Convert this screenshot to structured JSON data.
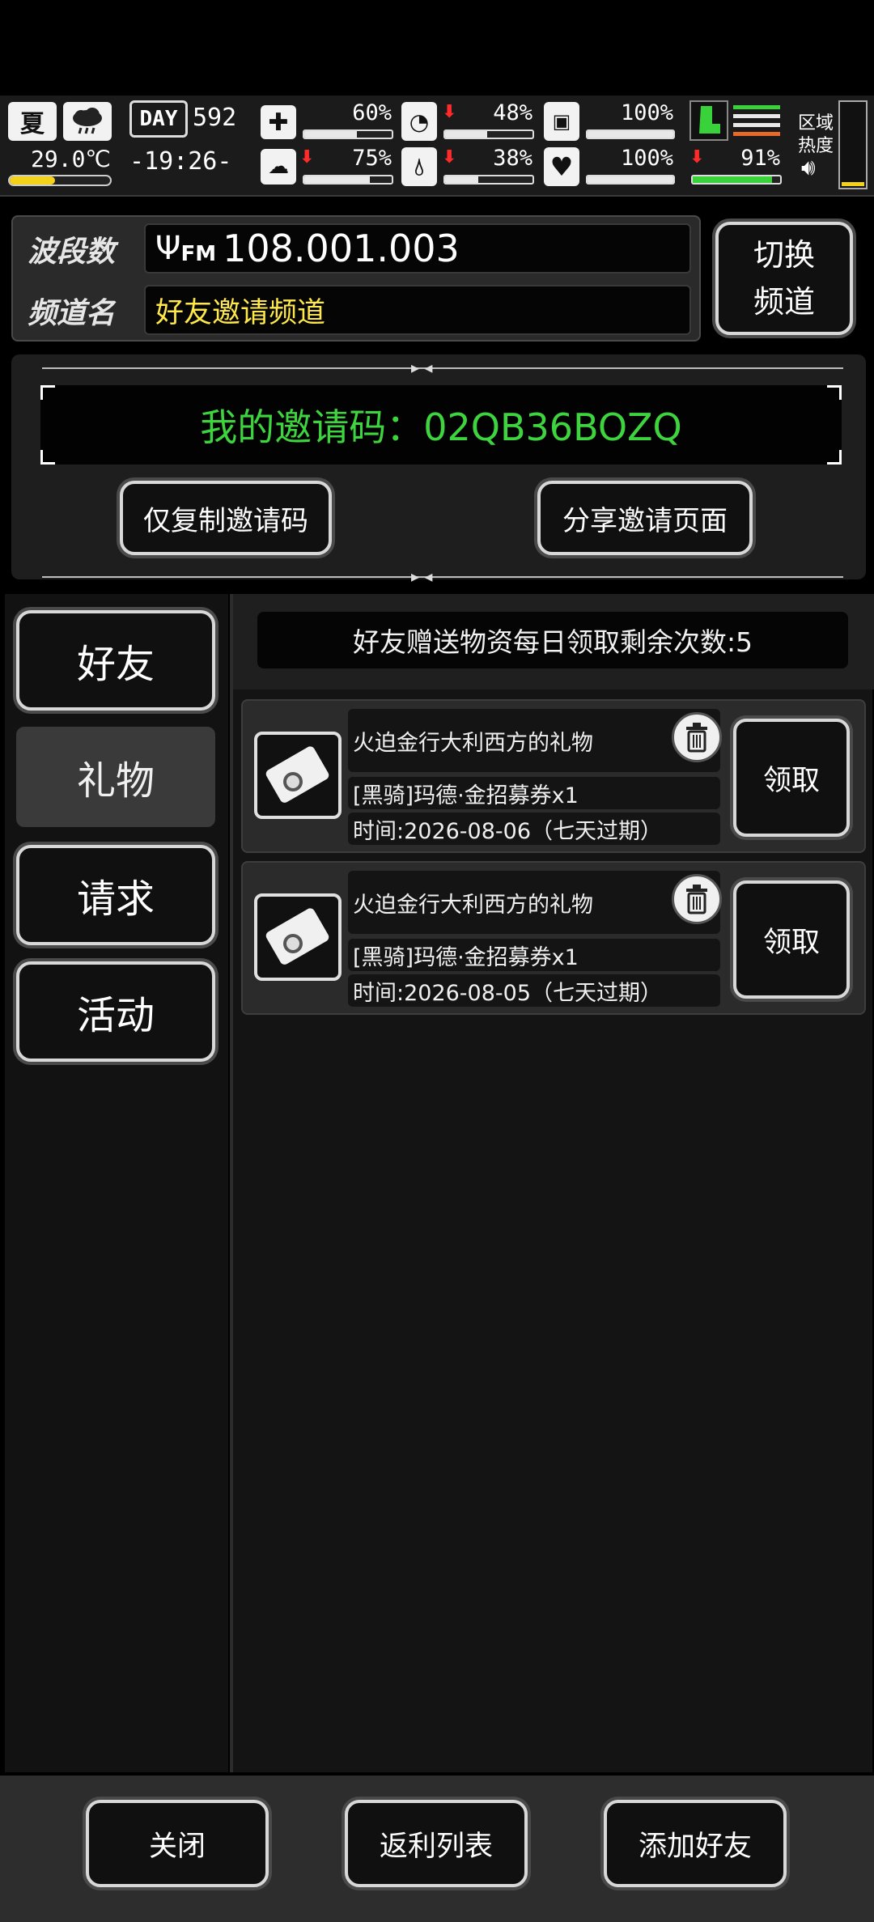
{
  "status": {
    "season": "夏",
    "temperature": "29.0℃",
    "day_label": "DAY",
    "day_number": "592",
    "clock": "-19:26-",
    "health_pct": "60%",
    "health_level": 0.6,
    "hunger_pct": "48%",
    "hunger_level": 0.48,
    "energy_pct": "100%",
    "energy_level": 1.0,
    "mental_pct": "75%",
    "mental_level": 0.75,
    "thirst_pct": "38%",
    "thirst_level": 0.38,
    "mood_pct": "100%",
    "mood_level": 1.0,
    "stamina_pct": "91%",
    "stamina_level": 0.91,
    "region_heat_line1": "区域",
    "region_heat_line2": "热度"
  },
  "channel": {
    "band_label": "波段数",
    "band_value": "108.001.003",
    "fm_label": "FM",
    "name_label": "频道名",
    "name_value": "好友邀请频道",
    "switch_line1": "切换",
    "switch_line2": "频道"
  },
  "invite": {
    "code_text": "我的邀请码：02QB36BOZQ",
    "copy_button": "仅复制邀请码",
    "share_button": "分享邀请页面"
  },
  "sidebar": {
    "items": [
      {
        "label": "好友"
      },
      {
        "label": "礼物"
      },
      {
        "label": "请求"
      },
      {
        "label": "活动"
      }
    ]
  },
  "main": {
    "notice": "好友赠送物资每日领取剩余次数:5",
    "gifts": [
      {
        "title": "火迫金行大利西方的礼物",
        "item": "[黑骑]玛德·金招募券x1",
        "time": "时间:2026-08-06（七天过期）",
        "claim": "领取"
      },
      {
        "title": "火迫金行大利西方的礼物",
        "item": "[黑骑]玛德·金招募券x1",
        "time": "时间:2026-08-05（七天过期）",
        "claim": "领取"
      }
    ]
  },
  "bottom": {
    "close": "关闭",
    "rebate_list": "返利列表",
    "add_friend": "添加好友"
  },
  "colors": {
    "invite_code": "#3ed43f",
    "channel_name": "#ffe94a",
    "low_arrow": "#ff2a2a",
    "stamina_bar": "#39d23b"
  }
}
